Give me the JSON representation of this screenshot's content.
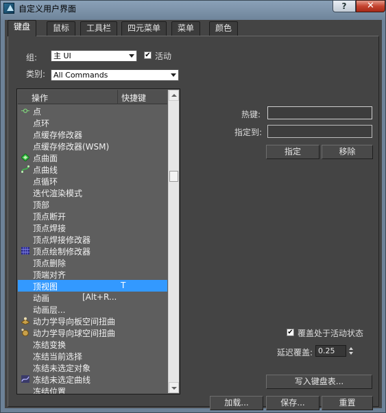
{
  "window": {
    "title": "自定义用户界面",
    "help_label": "?",
    "close_label": "✕"
  },
  "tabs": [
    {
      "label": "键盘",
      "active": true
    },
    {
      "label": "鼠标"
    },
    {
      "label": "工具栏"
    },
    {
      "label": "四元菜单"
    },
    {
      "label": "菜单"
    },
    {
      "label": "颜色"
    }
  ],
  "group": {
    "label": "组:",
    "value": "主 UI"
  },
  "active_toggle": {
    "label": "活动",
    "checked": true,
    "mark": "✔"
  },
  "category": {
    "label": "类别:",
    "value": "All Commands"
  },
  "list": {
    "header_action": "操作",
    "header_shortcut": "快捷键",
    "rows": [
      {
        "name": "点",
        "key": "",
        "icon": "point-icon"
      },
      {
        "name": "点环",
        "key": ""
      },
      {
        "name": "点缓存修改器",
        "key": ""
      },
      {
        "name": "点缓存修改器(WSM)",
        "key": ""
      },
      {
        "name": "点曲面",
        "key": "",
        "icon": "point-surface-icon"
      },
      {
        "name": "点曲线",
        "key": "",
        "icon": "point-curve-icon"
      },
      {
        "name": "点循环",
        "key": ""
      },
      {
        "name": "迭代渲染模式",
        "key": ""
      },
      {
        "name": "顶部",
        "key": ""
      },
      {
        "name": "顶点断开",
        "key": ""
      },
      {
        "name": "顶点焊接",
        "key": ""
      },
      {
        "name": "顶点焊接修改器",
        "key": ""
      },
      {
        "name": "顶点绘制修改器",
        "key": "",
        "icon": "vertex-paint-icon"
      },
      {
        "name": "顶点删除",
        "key": ""
      },
      {
        "name": "顶端对齐",
        "key": ""
      },
      {
        "name": "顶视图",
        "key": "T",
        "selected": true
      },
      {
        "name": "动画",
        "key": "[Alt+R..."
      },
      {
        "name": "动画层...",
        "key": ""
      },
      {
        "name": "动力学导向板空间扭曲",
        "key": "",
        "icon": "dynamics-plane-icon"
      },
      {
        "name": "动力学导向球空间扭曲",
        "key": "",
        "icon": "dynamics-sphere-icon"
      },
      {
        "name": "冻结变换",
        "key": ""
      },
      {
        "name": "冻结当前选择",
        "key": ""
      },
      {
        "name": "冻结未选定对象",
        "key": ""
      },
      {
        "name": "冻结未选定曲线",
        "key": "",
        "icon": "freeze-curve-icon"
      },
      {
        "name": "冻结位置",
        "key": ""
      }
    ]
  },
  "hotkey": {
    "label": "热键:",
    "value": ""
  },
  "assigned_to": {
    "label": "指定到:",
    "value": ""
  },
  "buttons": {
    "assign": "指定",
    "remove": "移除",
    "write_keyboard_chart": "写入键盘表...",
    "load": "加载...",
    "save": "保存...",
    "reset": "重置"
  },
  "override": {
    "label": "覆盖处于活动状态",
    "checked": true,
    "mark": "✔"
  },
  "delay_override": {
    "label": "延迟覆盖:",
    "value": "0.25"
  }
}
